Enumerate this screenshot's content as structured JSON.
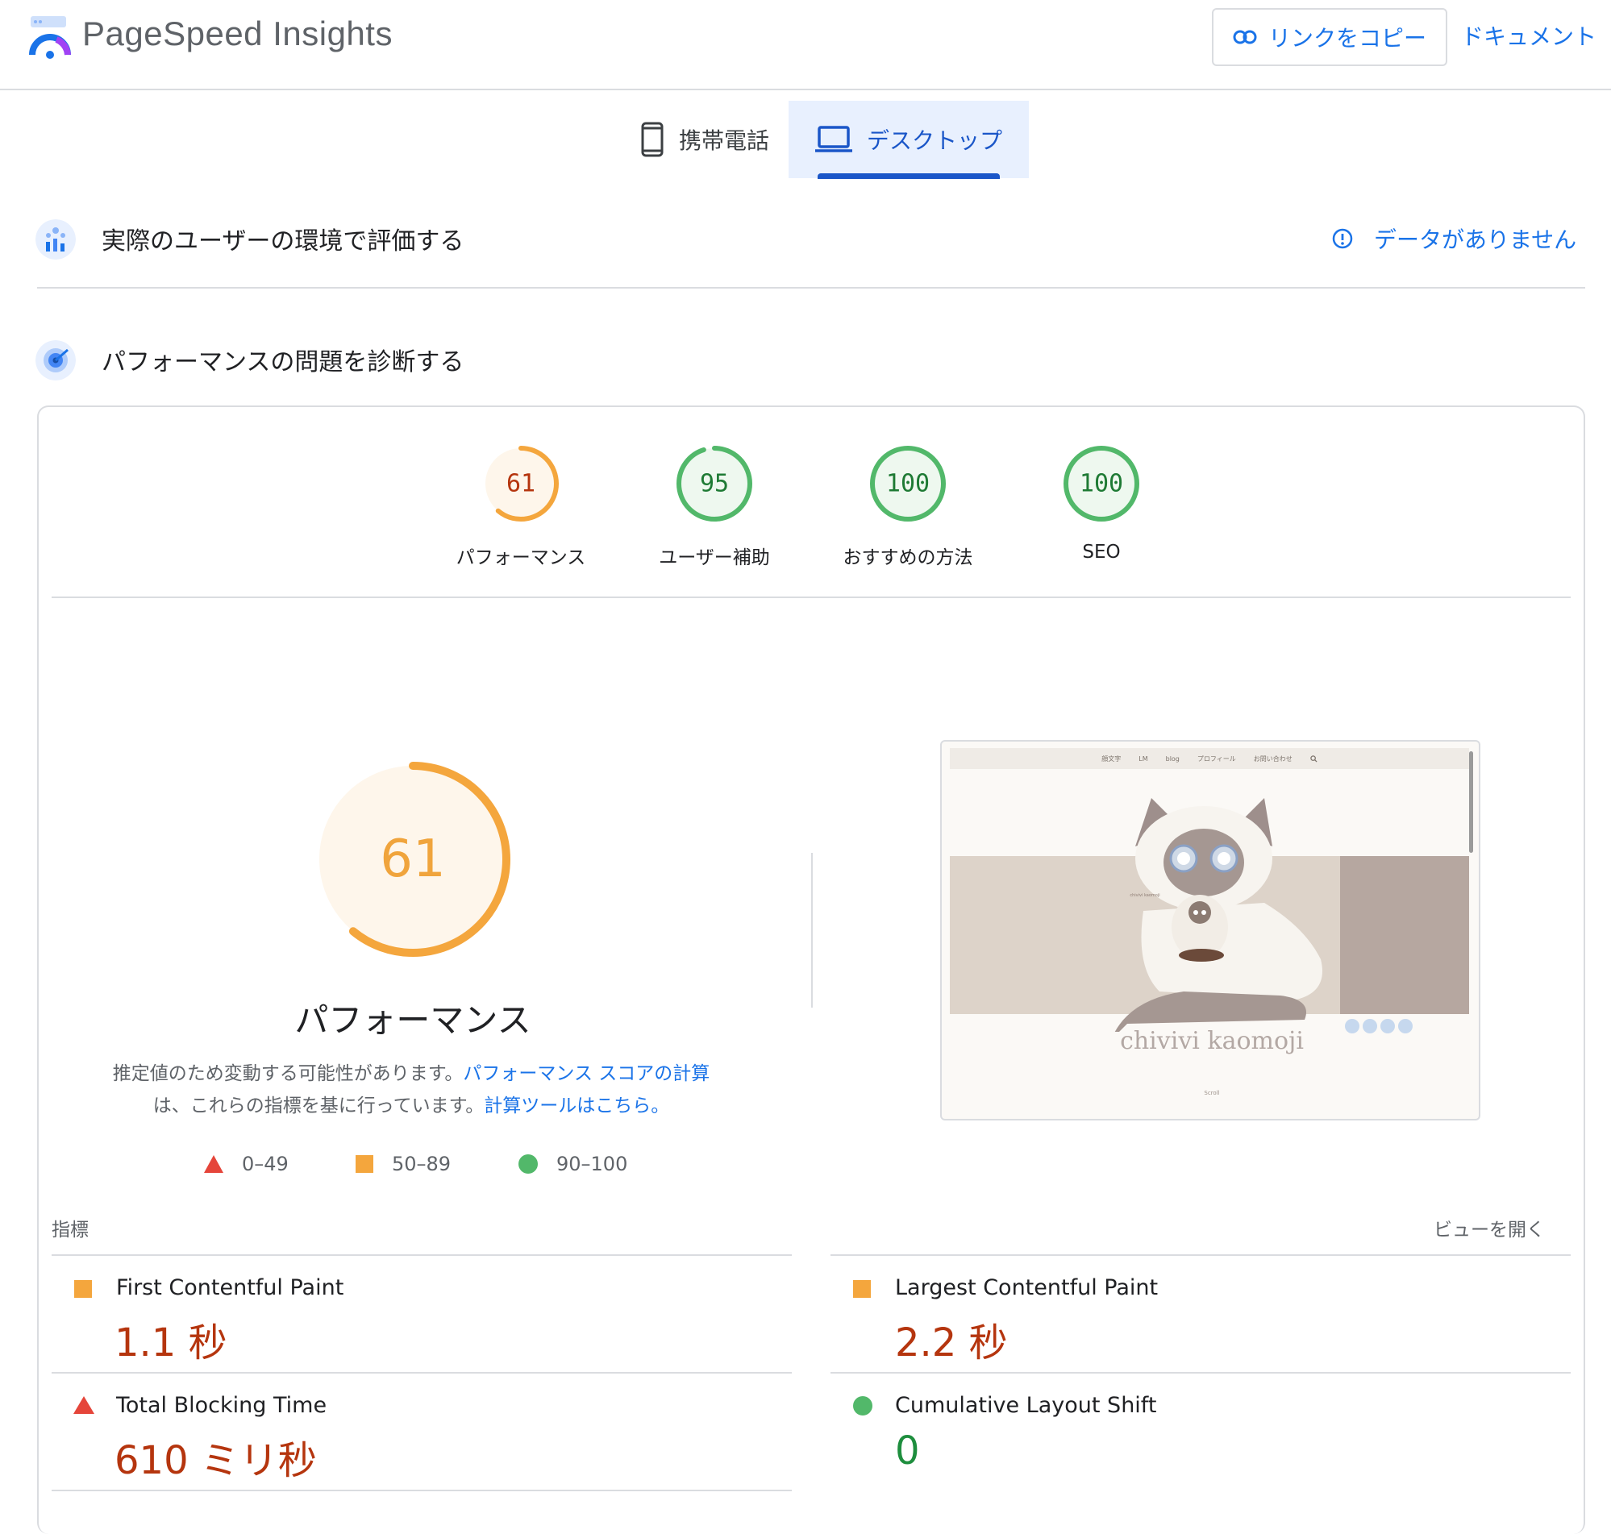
{
  "header": {
    "title": "PageSpeed Insights",
    "copy_link": "リンクをコピー",
    "docs": "ドキュメント"
  },
  "tabs": [
    {
      "label": "携帯電話",
      "icon": "smartphone-icon",
      "selected": false
    },
    {
      "label": "デスクトップ",
      "icon": "laptop-icon",
      "selected": true
    }
  ],
  "field_section": {
    "title": "実際のユーザーの環境で評価する",
    "status": "データがありません"
  },
  "diagnose_section": {
    "title": "パフォーマンスの問題を診断する"
  },
  "gauges": [
    {
      "score": "61",
      "value": 61,
      "label": "パフォーマンス",
      "color": "#f4a63d",
      "text_color": "#b5350e",
      "fill": "#fef6eb"
    },
    {
      "score": "95",
      "value": 95,
      "label": "ユーザー補助",
      "color": "#52b86a",
      "text_color": "#1e7a34",
      "fill": "#eef8ef"
    },
    {
      "score": "100",
      "value": 100,
      "label": "おすすめの方法",
      "color": "#52b86a",
      "text_color": "#1e7a34",
      "fill": "#eef8ef"
    },
    {
      "score": "100",
      "value": 100,
      "label": "SEO",
      "color": "#52b86a",
      "text_color": "#1e7a34",
      "fill": "#eef8ef"
    }
  ],
  "performance": {
    "score": "61",
    "value": 61,
    "label": "パフォーマンス",
    "desc_text1": "推定値のため変動する可能性があります。",
    "desc_link1": "パフォーマンス スコアの計算",
    "desc_text2": "は、これらの指標を基に行っています。",
    "desc_link2": "計算ツールはこちら。"
  },
  "legend": [
    {
      "shape": "triangle",
      "range": "0–49",
      "color": "#e5453a"
    },
    {
      "shape": "square",
      "range": "50–89",
      "color": "#f4a63d"
    },
    {
      "shape": "circle",
      "range": "90–100",
      "color": "#52b86a"
    }
  ],
  "thumbnail": {
    "nav": [
      "顔文字",
      "LM",
      "blog",
      "プロフィール",
      "お問い合わせ"
    ],
    "brand": "chivivi kaomoji",
    "small_text": "chivivi kaomoji",
    "scroll": "Scroll"
  },
  "metrics": {
    "label": "指標",
    "expand": "ビューを開く",
    "items": [
      {
        "name": "First Contentful Paint",
        "value": "1.1 秒",
        "status": "average"
      },
      {
        "name": "Largest Contentful Paint",
        "value": "2.2 秒",
        "status": "average"
      },
      {
        "name": "Total Blocking Time",
        "value": "610 ミリ秒",
        "status": "fail"
      },
      {
        "name": "Cumulative Layout Shift",
        "value": "0",
        "status": "pass"
      }
    ]
  }
}
